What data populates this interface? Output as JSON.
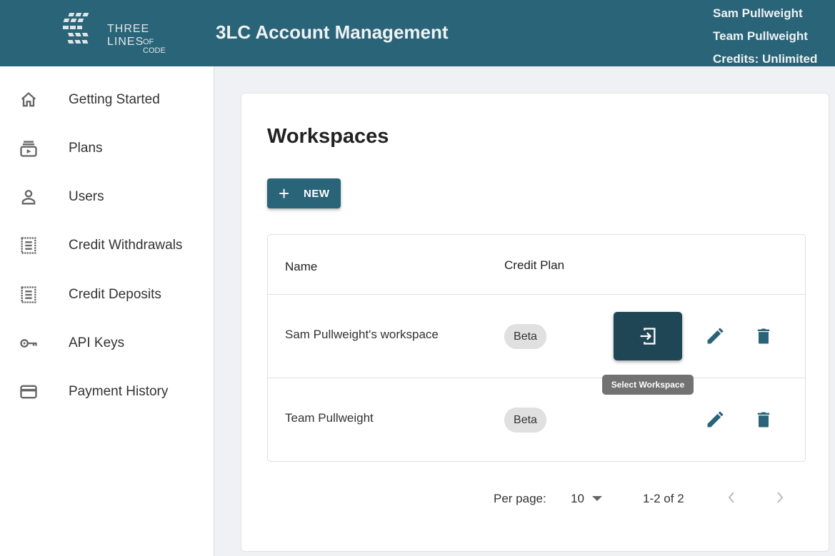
{
  "header": {
    "logo_text": "THREE LINES",
    "logo_sub": "OF CODE",
    "title": "3LC Account Management",
    "user_name": "Sam Pullweight",
    "team_name": "Team Pullweight",
    "credits": "Credits: Unlimited"
  },
  "sidebar": {
    "items": [
      {
        "label": "Getting Started",
        "icon": "home-icon"
      },
      {
        "label": "Plans",
        "icon": "subscriptions-icon"
      },
      {
        "label": "Users",
        "icon": "person-icon"
      },
      {
        "label": "Credit Withdrawals",
        "icon": "receipt-icon"
      },
      {
        "label": "Credit Deposits",
        "icon": "receipt-icon"
      },
      {
        "label": "API Keys",
        "icon": "key-icon"
      },
      {
        "label": "Payment History",
        "icon": "credit-card-icon"
      }
    ]
  },
  "main": {
    "title": "Workspaces",
    "new_label": "NEW",
    "columns": [
      "Name",
      "Credit Plan"
    ],
    "rows": [
      {
        "name": "Sam Pullweight's workspace",
        "plan": "Beta"
      },
      {
        "name": "Team Pullweight",
        "plan": "Beta"
      }
    ],
    "tooltip": "Select Workspace",
    "pagination": {
      "per_page_label": "Per page:",
      "per_page": "10",
      "range": "1-2 of 2"
    }
  },
  "colors": {
    "brand": "#2a6478",
    "select_button": "#1e4654"
  }
}
